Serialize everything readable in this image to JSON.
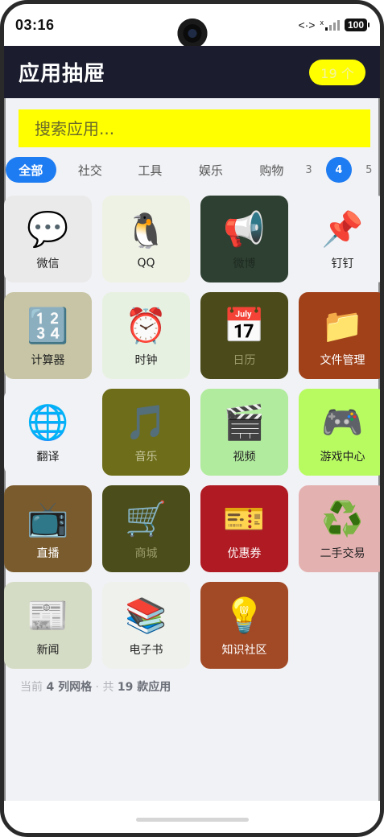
{
  "status_bar": {
    "time": "03:16",
    "network": "<·>",
    "sim": "x",
    "battery": "100"
  },
  "header": {
    "title": "应用抽屉",
    "count_badge": "19 个"
  },
  "search": {
    "placeholder": "搜索应用..."
  },
  "tabs": [
    {
      "label": "全部",
      "active": true
    },
    {
      "label": "社交",
      "active": false
    },
    {
      "label": "工具",
      "active": false
    },
    {
      "label": "娱乐",
      "active": false
    },
    {
      "label": "购物",
      "active": false
    }
  ],
  "columns": [
    {
      "label": "3",
      "active": false
    },
    {
      "label": "4",
      "active": true
    },
    {
      "label": "5",
      "active": false
    }
  ],
  "apps": [
    {
      "name": "微信",
      "icon": "speech-balloon",
      "glyph": "💬",
      "bg": "#eaeaea"
    },
    {
      "name": "QQ",
      "icon": "penguin",
      "glyph": "🐧",
      "bg": "#eef2e4"
    },
    {
      "name": "微博",
      "icon": "megaphone",
      "glyph": "📢",
      "bg": "#2e4032"
    },
    {
      "name": "钉钉",
      "icon": "pushpin",
      "glyph": "📌",
      "bg": "#f1f2f5"
    },
    {
      "name": "计算器",
      "icon": "input-numbers",
      "glyph": "🔢",
      "bg": "#c7c5a5"
    },
    {
      "name": "时钟",
      "icon": "alarm-clock",
      "glyph": "⏰",
      "bg": "#e7f1e1"
    },
    {
      "name": "日历",
      "icon": "calendar",
      "glyph": "📅",
      "bg": "#4a4a1a"
    },
    {
      "name": "文件管理",
      "icon": "folder",
      "glyph": "📁",
      "bg": "#a0411a"
    },
    {
      "name": "翻译",
      "icon": "globe",
      "glyph": "🌐",
      "bg": "#f1f2f5"
    },
    {
      "name": "音乐",
      "icon": "music-note",
      "glyph": "🎵",
      "bg": "#6d6d1a"
    },
    {
      "name": "视频",
      "icon": "clapper-board",
      "glyph": "🎬",
      "bg": "#b1eb9e"
    },
    {
      "name": "游戏中心",
      "icon": "game-controller",
      "glyph": "🎮",
      "bg": "#b8fb61"
    },
    {
      "name": "直播",
      "icon": "television",
      "glyph": "📺",
      "bg": "#7a5b2e"
    },
    {
      "name": "商城",
      "icon": "shopping-cart",
      "glyph": "🛒",
      "bg": "#4b4e1a"
    },
    {
      "name": "优惠券",
      "icon": "ticket",
      "glyph": "🎫",
      "bg": "#b01a22"
    },
    {
      "name": "二手交易",
      "icon": "recycle",
      "glyph": "♻️",
      "bg": "#e4b1b1"
    },
    {
      "name": "新闻",
      "icon": "newspaper",
      "glyph": "📰",
      "bg": "#d5dcc5"
    },
    {
      "name": "电子书",
      "icon": "books",
      "glyph": "📚",
      "bg": "#eef1ec"
    },
    {
      "name": "知识社区",
      "icon": "light-bulb",
      "glyph": "💡",
      "bg": "#a24a26"
    }
  ],
  "footer": {
    "prefix": "当前",
    "columns": "4 列网格",
    "sep": "·",
    "total_prefix": "共",
    "total": "19 款应用"
  }
}
